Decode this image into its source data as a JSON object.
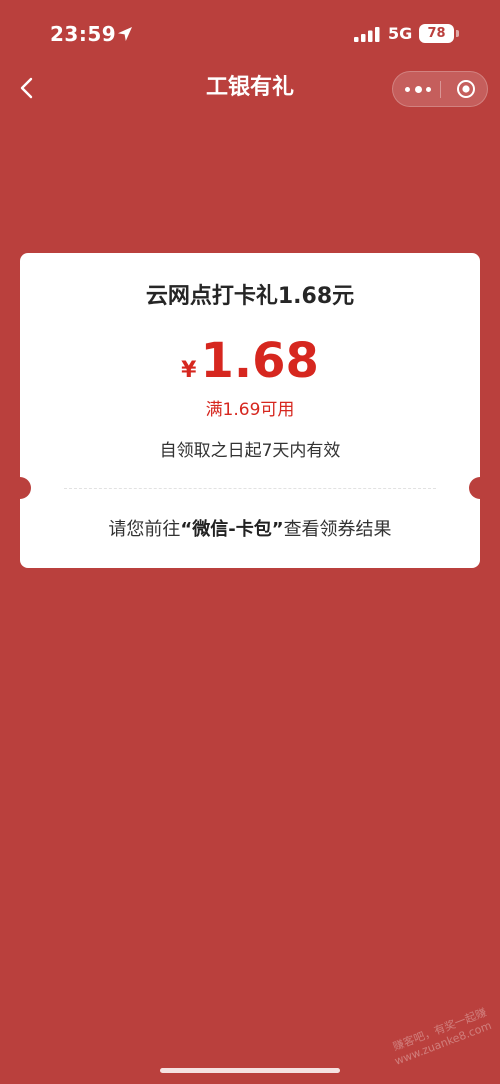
{
  "status_bar": {
    "time": "23:59",
    "location_icon": "location-arrow-icon",
    "signal_icon": "signal-bars-icon",
    "network": "5G",
    "battery": "78"
  },
  "nav": {
    "back_icon": "chevron-left-icon",
    "title": "工银有礼",
    "more_icon": "more-dots-icon",
    "close_icon": "target-circle-icon"
  },
  "coupon": {
    "title": "云网点打卡礼1.68元",
    "currency": "¥",
    "amount": "1.68",
    "condition": "满1.69可用",
    "validity": "自领取之日起7天内有效",
    "note_prefix": "请您前往",
    "note_highlight": "“微信-卡包”",
    "note_suffix": "查看领券结果"
  },
  "watermark": {
    "line1": "赚客吧，有奖一起赚",
    "line2": "www.zuanke8.com"
  },
  "colors": {
    "background": "#BA403D",
    "card": "#FFFFFF",
    "accent_red": "#D6271F",
    "text_dark": "#333333"
  }
}
